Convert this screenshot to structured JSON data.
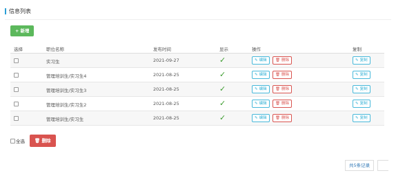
{
  "header": {
    "title": "信息列表"
  },
  "toolbar": {
    "add_icon": "+",
    "add_label": "新增"
  },
  "table": {
    "columns": [
      "选择",
      "职位名称",
      "发布时间",
      "显示",
      "操作",
      "复制"
    ],
    "edit_label": "编辑",
    "delete_label": "删除",
    "copy_label": "复制",
    "check_glyph": "✓",
    "rows": [
      {
        "name": "实习生",
        "date": "2021-09-27"
      },
      {
        "name": "管理培训生/实习生4",
        "date": "2021-08-25"
      },
      {
        "name": "管理培训生/实习生3",
        "date": "2021-08-25"
      },
      {
        "name": "管理培训生/实习生2",
        "date": "2021-08-25"
      },
      {
        "name": "管理培训生/实习生",
        "date": "2021-08-25"
      }
    ]
  },
  "footer": {
    "select_all_label": "全选",
    "delete_label": "删除",
    "total_label": "共5条记录"
  },
  "icons": {
    "add": "plus-icon",
    "edit": "pencil-icon",
    "delete": "trash-icon",
    "copy": "pencil-icon"
  },
  "colors": {
    "accent": "#2a9fd6",
    "success": "#5cb85c",
    "danger": "#d9534f",
    "info": "#31b0d5",
    "check": "#3c9c2e"
  }
}
